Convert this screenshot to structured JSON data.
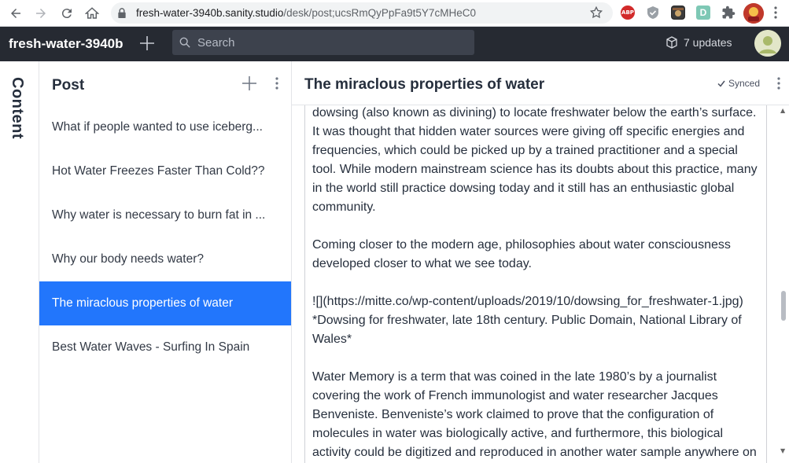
{
  "browser": {
    "url_host": "fresh-water-3940b.sanity.studio",
    "url_path": "/desk/post;ucsRmQyPpFa9t5Y7cMHeC0"
  },
  "navbar": {
    "project_name": "fresh-water-3940b",
    "search_placeholder": "Search",
    "updates_label": "7 updates"
  },
  "tool": {
    "label": "Content"
  },
  "list_pane": {
    "title": "Post",
    "items": [
      {
        "label": "What if people wanted to use iceberg...",
        "selected": false
      },
      {
        "label": "Hot Water Freezes Faster Than Cold??",
        "selected": false
      },
      {
        "label": "Why water is necessary to burn fat in ...",
        "selected": false
      },
      {
        "label": "Why our body needs water?",
        "selected": false
      },
      {
        "label": "The miraclous properties of water",
        "selected": true
      },
      {
        "label": "Best Water Waves - Surfing In Spain",
        "selected": false
      }
    ]
  },
  "editor": {
    "title": "The miraclous properties of water",
    "status": "Synced",
    "body": "dowsing (also known as divining) to locate freshwater below the earth’s surface. It was thought that hidden water sources were giving off specific energies and frequencies, which could be picked up by a trained practitioner and a special tool. While modern mainstream science has its doubts about this practice, many in the world still practice dowsing today and it still has an enthusiastic global community.\n\nComing closer to the modern age, philosophies about water consciousness developed closer to what we see today.\n\n![](https://mitte.co/wp-content/uploads/2019/10/dowsing_for_freshwater-1.jpg) *Dowsing for freshwater, late 18th century. Public Domain, National Library of Wales*\n\nWater Memory is a term that was coined in the late 1980’s by a journalist covering the work of French immunologist and water researcher Jacques Benveniste. Benveniste’s work claimed to prove that the configuration of molecules in water was biologically active, and furthermore, this biological activity could be digitized and reproduced in another water sample anywhere on"
  },
  "colors": {
    "navbar_bg": "#262a32",
    "selected_bg": "#2276fc"
  }
}
